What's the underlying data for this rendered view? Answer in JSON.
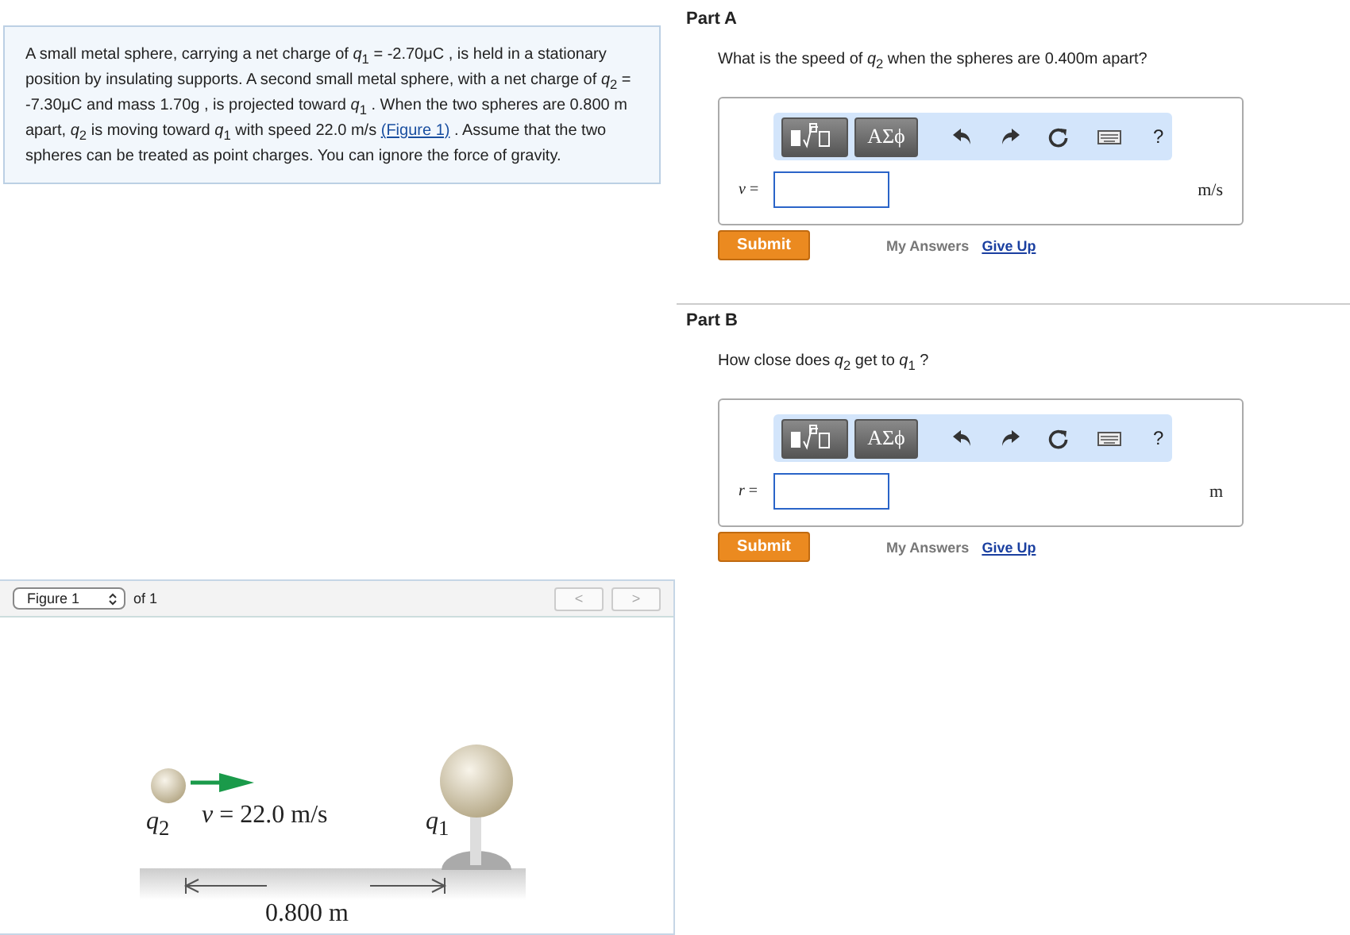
{
  "problem": {
    "text": "A small metal sphere, carrying a net charge of *q*$_{1}$ = -2.70μC , is held in a stationary position by insulating supports. A second small metal sphere, with a net charge of *q*$_{2}$ = -7.30μC and mass 1.70g , is projected toward *q*$_{1}$ . When the two spheres are 0.800 m apart, *q*$_{2}$ is moving toward *q*$_{1}$ with speed 22.0 m/s",
    "link": "(Figure 1)",
    "tail": ". Assume that the two spheres can be treated as point charges. You can ignore the force of gravity."
  },
  "figure": {
    "select": "Figure 1",
    "of": "of 1",
    "prev": "<",
    "next": ">",
    "labels": {
      "q2": "*q*$_{2}$",
      "v": "*v* = 22.0 m/s",
      "q1": "*q*$_{1}$",
      "dist": "0.800 m"
    }
  },
  "parts": [
    {
      "title": "Part A",
      "question": "What is the speed of *q*$_{2}$ when the spheres are 0.400m apart?",
      "greek": "ΑΣϕ",
      "help": "?",
      "variable": "*v* =",
      "unit": "m/s",
      "submit": "Submit",
      "my_answers": "My Answers",
      "give_up": "Give Up"
    },
    {
      "title": "Part B",
      "question": "How close does *q*$_{2}$ get to *q*$_{1}$ ?",
      "greek": "ΑΣϕ",
      "help": "?",
      "variable": "*r* =",
      "unit": "m",
      "submit": "Submit",
      "my_answers": "My Answers",
      "give_up": "Give Up"
    }
  ]
}
